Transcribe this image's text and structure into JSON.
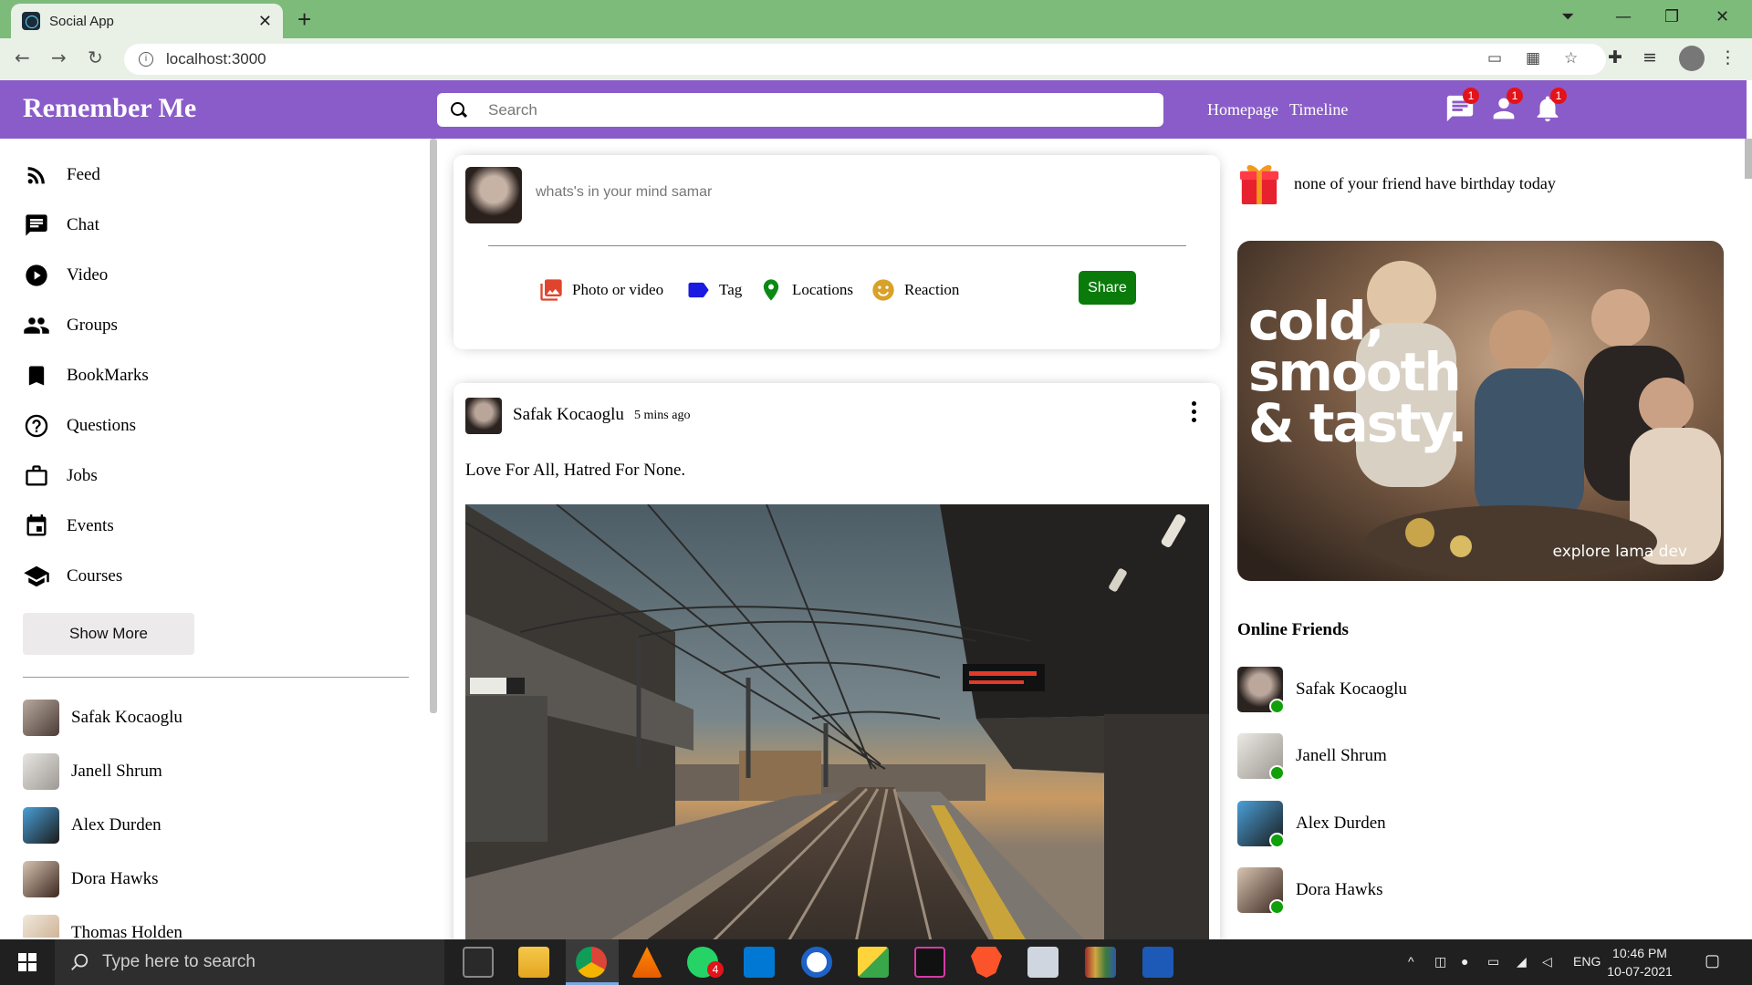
{
  "browser": {
    "tab_title": "Social App",
    "url": "localhost:3000"
  },
  "app": {
    "logo": "Remember Me",
    "search_placeholder": "Search",
    "nav_links": [
      "Homepage",
      "Timeline"
    ],
    "badges": {
      "chat": "1",
      "friends": "1",
      "notifications": "1"
    }
  },
  "sidebar": {
    "items": [
      {
        "label": "Feed",
        "icon": "rss-feed-icon"
      },
      {
        "label": "Chat",
        "icon": "chat-icon"
      },
      {
        "label": "Video",
        "icon": "play-circle-icon"
      },
      {
        "label": "Groups",
        "icon": "group-icon"
      },
      {
        "label": "BookMarks",
        "icon": "bookmark-icon"
      },
      {
        "label": "Questions",
        "icon": "help-outline-icon"
      },
      {
        "label": "Jobs",
        "icon": "work-outline-icon"
      },
      {
        "label": "Events",
        "icon": "event-icon"
      },
      {
        "label": "Courses",
        "icon": "school-icon"
      }
    ],
    "show_more": "Show More",
    "friends": [
      "Safak Kocaoglu",
      "Janell Shrum",
      "Alex Durden",
      "Dora Hawks",
      "Thomas Holden"
    ]
  },
  "share": {
    "placeholder": "whats's in your mind samar",
    "options": [
      "Photo or video",
      "Tag",
      "Locations",
      "Reaction"
    ],
    "button": "Share"
  },
  "post": {
    "author": "Safak Kocaoglu",
    "time": "5 mins ago",
    "text": "Love For All, Hatred For None."
  },
  "rightbar": {
    "birthday_text": "none of your friend have birthday today",
    "ad_headline": "cold,\nsmooth\n& tasty.",
    "ad_sub": "explore lama dev",
    "online_title": "Online Friends",
    "online": [
      "Safak Kocaoglu",
      "Janell Shrum",
      "Alex Durden",
      "Dora Hawks"
    ]
  },
  "taskbar": {
    "search_placeholder": "Type here to search",
    "language": "ENG",
    "time": "10:46 PM",
    "date": "10-07-2021",
    "whatsapp_badge": "4"
  },
  "colors": {
    "topbar": "#8a5cc9",
    "share_button": "#0a7a0a",
    "online_dot": "#10a00a",
    "badge": "#e2131a"
  }
}
